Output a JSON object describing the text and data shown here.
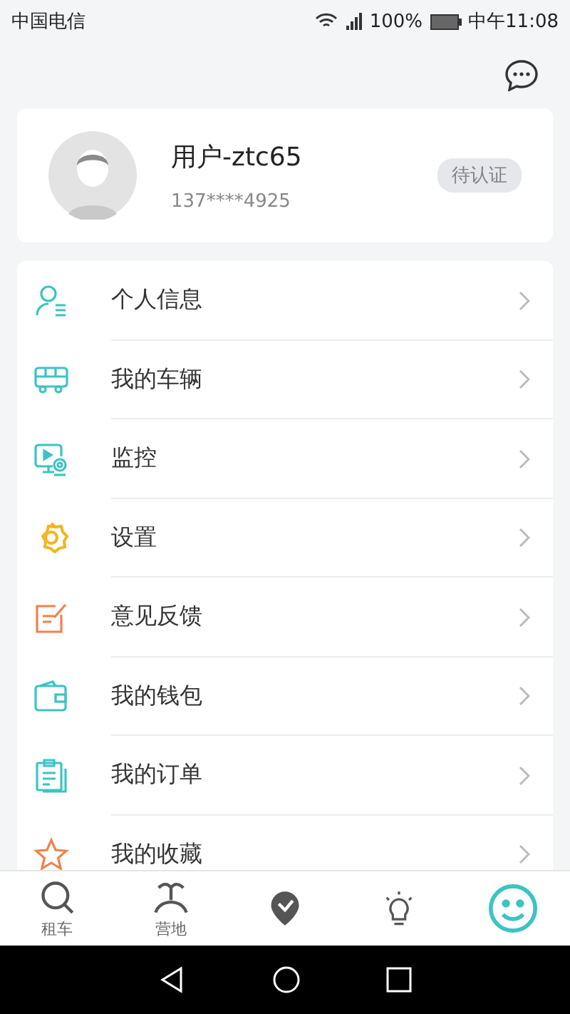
{
  "status_bar": {
    "carrier": "中国电信",
    "battery": "100%",
    "time": "中午11:08"
  },
  "profile": {
    "name": "用户-ztc65",
    "phone": "137****4925",
    "badge": "待认证"
  },
  "menu": [
    {
      "label": "个人信息"
    },
    {
      "label": "我的车辆"
    },
    {
      "label": "监控"
    },
    {
      "label": "设置"
    },
    {
      "label": "意见反馈"
    },
    {
      "label": "我的钱包"
    },
    {
      "label": "我的订单"
    },
    {
      "label": "我的收藏"
    }
  ],
  "tabs": [
    {
      "label": "租车",
      "selected": false
    },
    {
      "label": "营地",
      "selected": false
    },
    {
      "selected": false
    },
    {
      "selected": false
    },
    {
      "selected": true
    }
  ]
}
